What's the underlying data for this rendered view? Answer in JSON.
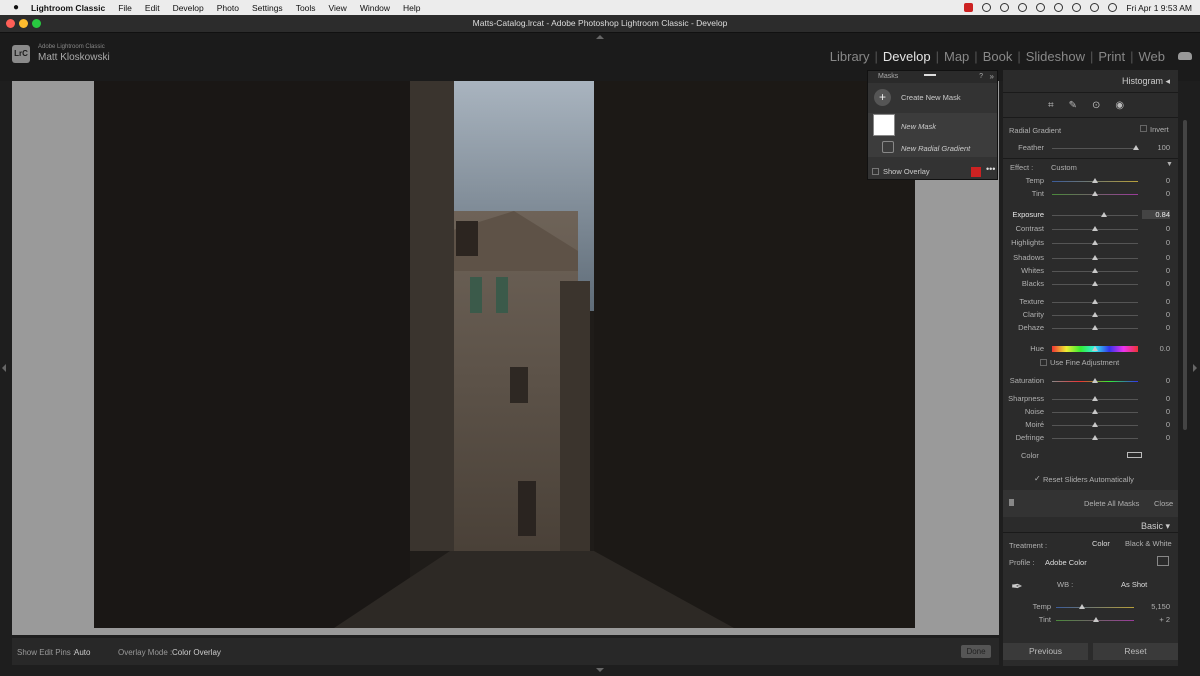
{
  "menubar": {
    "apple": "",
    "app_name": "Lightroom Classic",
    "items": [
      "File",
      "Edit",
      "Develop",
      "Photo",
      "Settings",
      "Tools",
      "View",
      "Window",
      "Help"
    ],
    "clock": "Fri Apr 1  9:53 AM"
  },
  "window": {
    "title": "Matts-Catalog.lrcat - Adobe Photoshop Lightroom Classic - Develop"
  },
  "identity": {
    "logo": "LrC",
    "product": "Adobe Lightroom Classic",
    "user": "Matt Kloskowski"
  },
  "modules": [
    "Library",
    "Develop",
    "Map",
    "Book",
    "Slideshow",
    "Print",
    "Web"
  ],
  "active_module": "Develop",
  "toolbar": {
    "edit_pins_label": "Show Edit Pins :",
    "edit_pins_value": "Auto",
    "overlay_mode_label": "Overlay Mode :",
    "overlay_mode_value": "Color Overlay",
    "done": "Done"
  },
  "masks": {
    "title": "Masks",
    "create": "Create New Mask",
    "mask_name": "New Mask",
    "component": "New Radial Gradient",
    "show_overlay": "Show Overlay",
    "overlay_color": "#cc2222"
  },
  "panel": {
    "histogram": "Histogram",
    "mask_type": "Radial Gradient",
    "invert": "Invert",
    "feather_label": "Feather",
    "feather_value": "100",
    "effect_label": "Effect :",
    "effect_value": "Custom",
    "sliders": [
      {
        "label": "Temp",
        "value": "0"
      },
      {
        "label": "Tint",
        "value": "0"
      },
      {
        "label": "Exposure",
        "value": "0.84"
      },
      {
        "label": "Contrast",
        "value": "0"
      },
      {
        "label": "Highlights",
        "value": "0"
      },
      {
        "label": "Shadows",
        "value": "0"
      },
      {
        "label": "Whites",
        "value": "0"
      },
      {
        "label": "Blacks",
        "value": "0"
      },
      {
        "label": "Texture",
        "value": "0"
      },
      {
        "label": "Clarity",
        "value": "0"
      },
      {
        "label": "Dehaze",
        "value": "0"
      },
      {
        "label": "Hue",
        "value": "0.0"
      },
      {
        "label": "Saturation",
        "value": "0"
      },
      {
        "label": "Sharpness",
        "value": "0"
      },
      {
        "label": "Noise",
        "value": "0"
      },
      {
        "label": "Moiré",
        "value": "0"
      },
      {
        "label": "Defringe",
        "value": "0"
      }
    ],
    "fine_adjust": "Use Fine Adjustment",
    "color_label": "Color",
    "reset_sliders": "Reset Sliders Automatically",
    "delete_all": "Delete All Masks",
    "close": "Close",
    "basic": "Basic",
    "treatment_label": "Treatment :",
    "treatment_color": "Color",
    "treatment_bw": "Black & White",
    "profile_label": "Profile :",
    "profile_value": "Adobe Color",
    "wb_label": "WB :",
    "wb_value": "As Shot",
    "basic_temp_label": "Temp",
    "basic_temp_value": "5,150",
    "basic_tint_label": "Tint",
    "basic_tint_value": "+ 2",
    "previous": "Previous",
    "reset": "Reset"
  }
}
